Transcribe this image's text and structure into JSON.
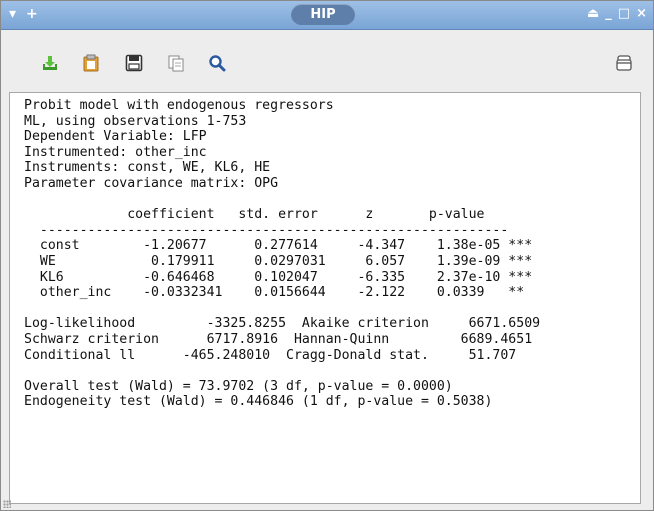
{
  "window": {
    "title": "HIP",
    "left_controls": [
      "▾",
      "+"
    ],
    "right_controls": [
      "⏏",
      "_",
      "□",
      "×"
    ]
  },
  "toolbar": {
    "buttons": [
      {
        "name": "save-text-button",
        "icon": "save-green-icon"
      },
      {
        "name": "copy-button",
        "icon": "clipboard-icon"
      },
      {
        "name": "save-file-button",
        "icon": "floppy-icon"
      },
      {
        "name": "print-button",
        "icon": "copy-gray-icon"
      },
      {
        "name": "search-button",
        "icon": "magnifier-icon"
      },
      {
        "name": "window-list-button",
        "icon": "stack-icon"
      }
    ]
  },
  "output": {
    "header": [
      "Probit model with endogenous regressors",
      "ML, using observations 1-753",
      "Dependent Variable: LFP",
      "Instrumented: other_inc",
      "Instruments: const, WE, KL6, HE",
      "Parameter covariance matrix: OPG"
    ],
    "table_header": "             coefficient   std. error      z       p-value",
    "table_rule": "  -----------------------------------------------------------",
    "rows": [
      "  const        -1.20677      0.277614     -4.347    1.38e-05 ***",
      "  WE            0.179911     0.0297031     6.057    1.39e-09 ***",
      "  KL6          -0.646468     0.102047     -6.335    2.37e-10 ***",
      "  other_inc    -0.0332341    0.0156644    -2.122    0.0339   **"
    ],
    "stats": [
      "Log-likelihood         -3325.8255  Akaike criterion     6671.6509",
      "Schwarz criterion      6717.8916  Hannan-Quinn         6689.4651",
      "Conditional ll      -465.248010  Cragg-Donald stat.     51.707"
    ],
    "tests": [
      "Overall test (Wald) = 73.9702 (3 df, p-value = 0.0000)",
      "Endogeneity test (Wald) = 0.446846 (1 df, p-value = 0.5038)"
    ]
  }
}
